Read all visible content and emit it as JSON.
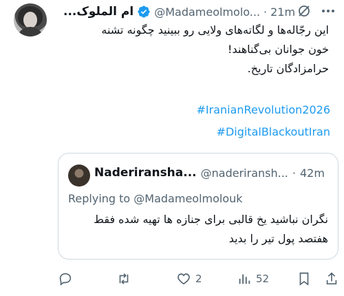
{
  "tweet": {
    "author_name": "ام الملوک...",
    "handle": "@Madameolmolo...",
    "separator": "·",
    "time": "21m",
    "body_lines": [
      "این رجّاله‌ها و لگاته‌های ولایی رو ببینید چگونه تشنه",
      "خون جوانان بی‌گناهند!",
      "حرامزادگان تاریخ."
    ],
    "hashtags": [
      "#IranianRevolution2026",
      "#DigitalBlackoutIran"
    ]
  },
  "quote": {
    "author_name": "Naderiransha...",
    "handle": "@naderiransh...",
    "separator": "·",
    "time": "42m",
    "replying_to": "Replying to @Madameolmolouk",
    "body_lines": [
      "نگران نباشید یخ قالبی برای جنازه ها تهیه شده فقط",
      "هفتصد پول تیر را بدید"
    ]
  },
  "actions": {
    "reply_count": "",
    "retweet_count": "",
    "like_count": "2",
    "views_count": "52"
  },
  "colors": {
    "accent": "#1d9bf0",
    "muted": "#536471",
    "border": "#cfd9de"
  }
}
